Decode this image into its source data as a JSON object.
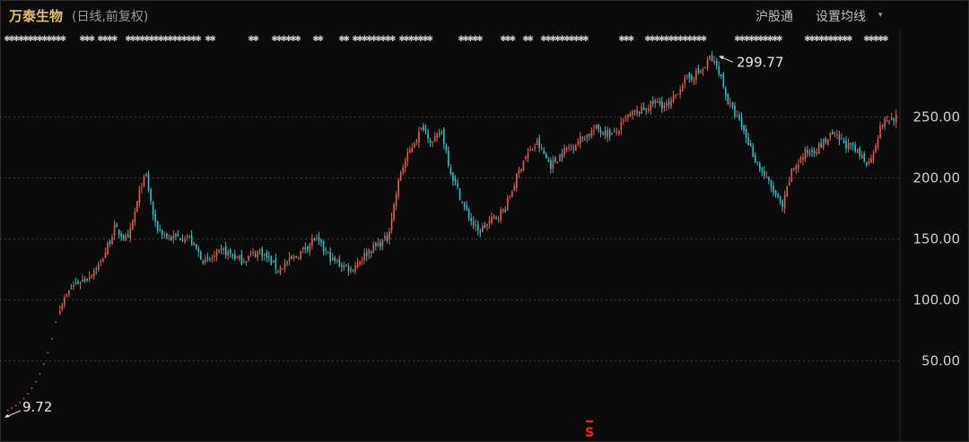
{
  "header": {
    "stock_name": "万泰生物",
    "mode": "(日线,前复权)",
    "hgt_label": "沪股通",
    "ma_label": "设置均线",
    "ma_caret": "▾"
  },
  "colors": {
    "up": "#e25b4b",
    "down": "#27c1c8",
    "grid": "#3a3a3a",
    "background": "#0b0b0c",
    "label": "#cfcfcf",
    "title": "#e2c36a",
    "marker": "#ff2020"
  },
  "chart_data": {
    "type": "candlestick",
    "y_axis_ticks": [
      "250.00",
      "200.00",
      "150.00",
      "100.00",
      "50.00"
    ],
    "ylim": [
      0,
      300
    ],
    "grid": true,
    "annotations": [
      {
        "label": "299.77",
        "value": 299.77,
        "kind": "high"
      },
      {
        "label": "9.72",
        "value": 9.72,
        "kind": "low"
      }
    ],
    "bottom_marker": "S",
    "ipo_run": [
      9.72,
      11.5,
      13.6,
      16.2,
      19.3,
      23.1,
      27.6,
      33.0,
      39.6,
      47.5,
      57.0,
      68.4,
      82.0,
      94.5
    ],
    "waypoints": [
      [
        0,
        94
      ],
      [
        6,
        112
      ],
      [
        12,
        118
      ],
      [
        18,
        130
      ],
      [
        24,
        158
      ],
      [
        30,
        148
      ],
      [
        36,
        195
      ],
      [
        38,
        200
      ],
      [
        42,
        160
      ],
      [
        48,
        150
      ],
      [
        56,
        152
      ],
      [
        64,
        130
      ],
      [
        72,
        140
      ],
      [
        80,
        132
      ],
      [
        88,
        140
      ],
      [
        96,
        125
      ],
      [
        104,
        135
      ],
      [
        112,
        150
      ],
      [
        120,
        132
      ],
      [
        128,
        125
      ],
      [
        136,
        140
      ],
      [
        144,
        150
      ],
      [
        150,
        205
      ],
      [
        156,
        230
      ],
      [
        160,
        242
      ],
      [
        164,
        228
      ],
      [
        168,
        238
      ],
      [
        172,
        205
      ],
      [
        178,
        175
      ],
      [
        184,
        155
      ],
      [
        190,
        165
      ],
      [
        196,
        175
      ],
      [
        204,
        215
      ],
      [
        210,
        228
      ],
      [
        216,
        210
      ],
      [
        222,
        222
      ],
      [
        228,
        230
      ],
      [
        236,
        240
      ],
      [
        244,
        235
      ],
      [
        250,
        250
      ],
      [
        256,
        255
      ],
      [
        262,
        262
      ],
      [
        268,
        258
      ],
      [
        274,
        278
      ],
      [
        280,
        285
      ],
      [
        284,
        290
      ],
      [
        286,
        299
      ],
      [
        290,
        288
      ],
      [
        294,
        262
      ],
      [
        300,
        242
      ],
      [
        306,
        215
      ],
      [
        312,
        195
      ],
      [
        318,
        175
      ],
      [
        322,
        205
      ],
      [
        328,
        220
      ],
      [
        334,
        225
      ],
      [
        340,
        235
      ],
      [
        348,
        225
      ],
      [
        356,
        212
      ],
      [
        362,
        245
      ],
      [
        368,
        250
      ]
    ]
  }
}
